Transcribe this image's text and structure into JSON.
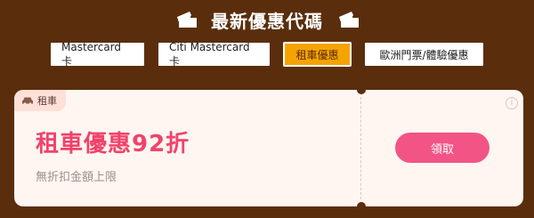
{
  "header": {
    "title": "最新優惠代碼"
  },
  "tabs": [
    {
      "label": "Mastercard 卡"
    },
    {
      "label": "Citi Mastercard 卡"
    },
    {
      "label": "租車優惠"
    },
    {
      "label": "歐洲門票/體驗優惠"
    }
  ],
  "coupon": {
    "tag": "租車",
    "title": "租車優惠92折",
    "subtitle": "無折扣金額上限",
    "button": "領取",
    "info": "i"
  },
  "colors": {
    "background": "#5a2e0c",
    "active_tab": "#f5a300",
    "accent": "#f0436b",
    "button": "#f25486"
  }
}
